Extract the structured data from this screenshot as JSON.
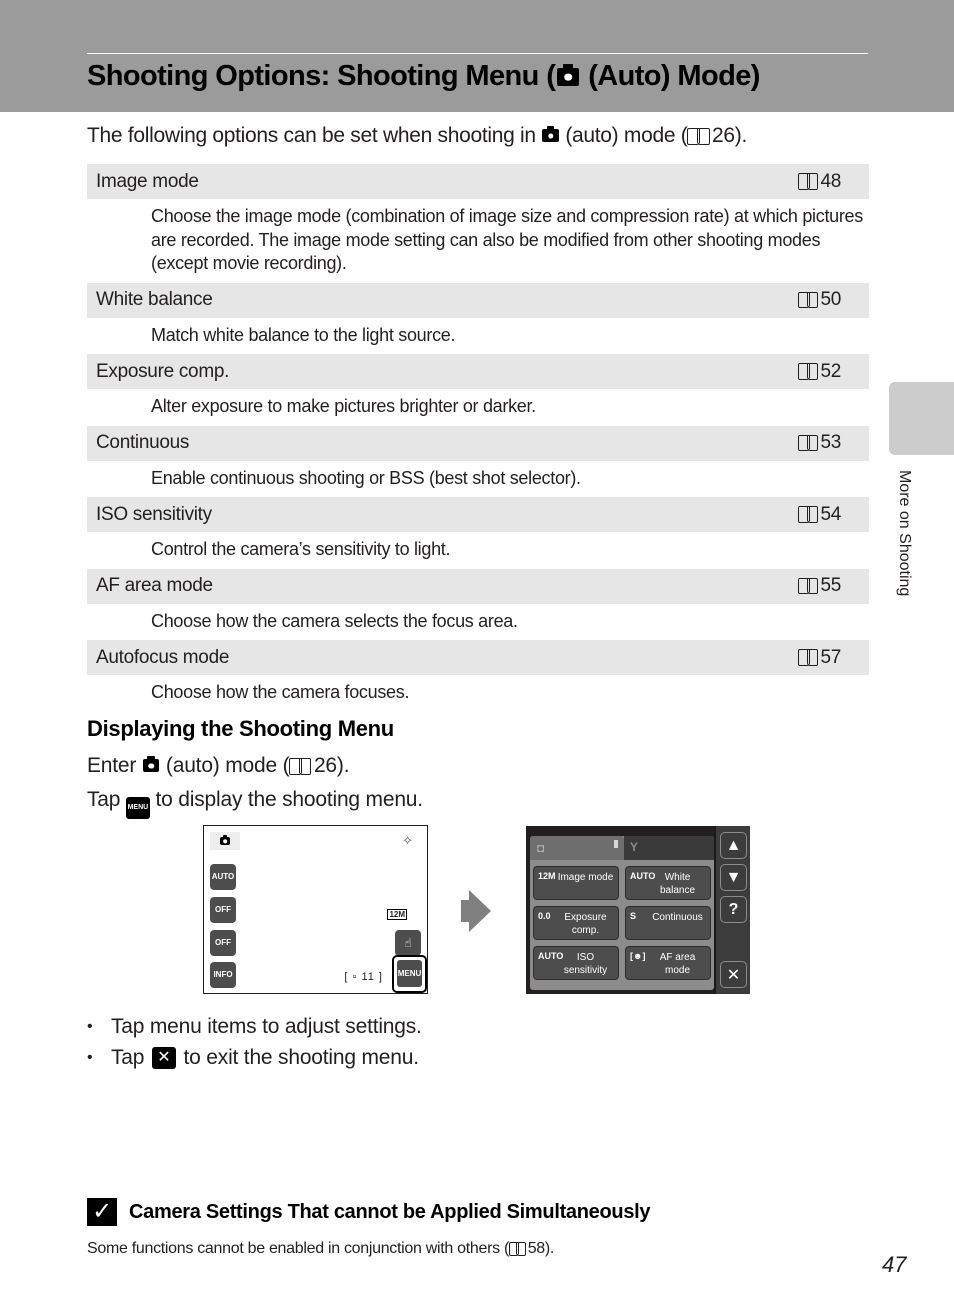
{
  "header": {
    "title_pre": "Shooting Options: Shooting Menu (",
    "title_icon": "camera-icon",
    "title_post": " (Auto) Mode)"
  },
  "intro": {
    "text_pre": "The following options can be set when shooting in ",
    "text_mid": " (auto) mode (",
    "ref": "26",
    "text_post": ")."
  },
  "options": [
    {
      "name": "Image mode",
      "ref": "48",
      "desc": "Choose the image mode (combination of image size and compression rate) at which pictures are recorded. The image mode setting can also be modified from other shooting modes (except movie recording)."
    },
    {
      "name": "White balance",
      "ref": "50",
      "desc": "Match white balance to the light source."
    },
    {
      "name": "Exposure comp.",
      "ref": "52",
      "desc": "Alter exposure to make pictures brighter or darker."
    },
    {
      "name": "Continuous",
      "ref": "53",
      "desc": "Enable continuous shooting or BSS (best shot selector)."
    },
    {
      "name": "ISO sensitivity",
      "ref": "54",
      "desc": "Control the camera’s sensitivity to light."
    },
    {
      "name": "AF area mode",
      "ref": "55",
      "desc": "Choose how the camera selects the focus area."
    },
    {
      "name": "Autofocus mode",
      "ref": "57",
      "desc": "Choose how the camera focuses."
    }
  ],
  "displaying": {
    "title": "Displaying the Shooting Menu",
    "step1_pre": "Enter ",
    "step1_mid": " (auto) mode (",
    "step1_ref": "26",
    "step1_post": ").",
    "step2_pre": "Tap ",
    "step2_icon_label": "MENU",
    "step2_post": " to display the shooting menu."
  },
  "screen1": {
    "flash_label": "AUTO",
    "selftimer_label": "OFF",
    "macro_label": "OFF",
    "info_label": "INFO",
    "image_mode_badge": "12M",
    "frames_remaining": "[ ▫  11 ]",
    "menu_label": "MENU"
  },
  "screen2": {
    "items": [
      {
        "icon": "12M",
        "label": "Image mode"
      },
      {
        "icon": "AUTO",
        "label": "White balance"
      },
      {
        "icon": "0.0",
        "label": "Exposure comp."
      },
      {
        "icon": "S",
        "label": "Continuous"
      },
      {
        "icon": "AUTO",
        "label": "ISO sensitivity"
      },
      {
        "icon": "[☻]",
        "label": "AF area mode"
      }
    ],
    "up_label": "▲",
    "down_label": "▼",
    "help_label": "?",
    "close_label": "✕"
  },
  "bullets": {
    "item1": "Tap menu items to adjust settings.",
    "item2_pre": "Tap ",
    "item2_icon": "✕",
    "item2_post": " to exit the shooting menu.",
    "dot": "•"
  },
  "note": {
    "check": "✓",
    "title": "Camera Settings That cannot be Applied Simultaneously",
    "body_pre": "Some functions cannot be enabled in conjunction with others (",
    "body_ref": "58",
    "body_post": ")."
  },
  "side_tab": {
    "label": "More on Shooting"
  },
  "page_number": "47"
}
